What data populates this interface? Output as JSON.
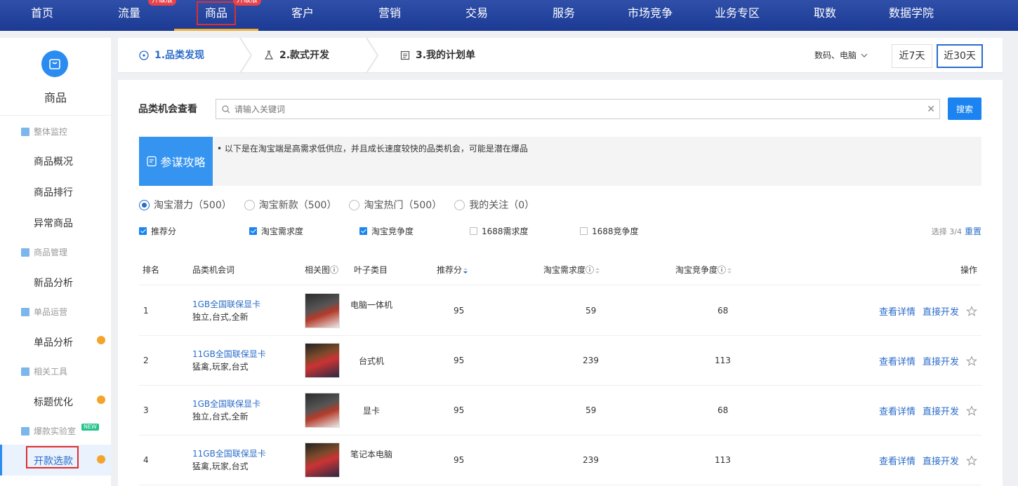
{
  "topnav": {
    "items": [
      {
        "label": "首页"
      },
      {
        "label": "流量",
        "badge": "升级版"
      },
      {
        "label": "商品",
        "badge": "升级版",
        "active": true
      },
      {
        "label": "客户"
      },
      {
        "label": "营销"
      },
      {
        "label": "交易"
      },
      {
        "label": "服务"
      },
      {
        "label": "市场竞争"
      },
      {
        "label": "业务专区"
      },
      {
        "label": "取数"
      },
      {
        "label": "数据学院"
      }
    ]
  },
  "sidebar": {
    "title": "商品",
    "groups": [
      {
        "label": "整体监控",
        "items": [
          "商品概况",
          "商品排行",
          "异常商品"
        ]
      },
      {
        "label": "商品管理",
        "items": [
          "新品分析"
        ]
      },
      {
        "label": "单品运营",
        "items": [
          "单品分析"
        ]
      },
      {
        "label": "相关工具",
        "items": [
          "标题优化"
        ]
      },
      {
        "label": "爆款实验室",
        "tag": "NEW",
        "items": [
          "开款选款"
        ]
      }
    ]
  },
  "steps": [
    {
      "label": "1.品类发现",
      "icon": "compass-icon",
      "active": true
    },
    {
      "label": "2.款式开发",
      "icon": "flask-icon"
    },
    {
      "label": "3.我的计划单",
      "icon": "list-icon"
    }
  ],
  "category_select": "数码、电脑",
  "ranges": [
    "近7天",
    "近30天"
  ],
  "search": {
    "title": "品类机会查看",
    "placeholder": "请输入关键词",
    "button": "搜索"
  },
  "tips": {
    "badge": "参谋攻略",
    "text": "• 以下是在淘宝端是高需求低供应，并且成长速度较快的品类机会，可能是潜在爆品"
  },
  "radios": [
    "淘宝潜力（500）",
    "淘宝新款（500）",
    "淘宝热门（500）",
    "我的关注（0）"
  ],
  "checks": [
    {
      "label": "推荐分",
      "checked": true
    },
    {
      "label": "淘宝需求度",
      "checked": true
    },
    {
      "label": "淘宝竞争度",
      "checked": true
    },
    {
      "label": "1688需求度",
      "checked": false
    },
    {
      "label": "1688竞争度",
      "checked": false
    }
  ],
  "selection": {
    "info": "选择 3/4",
    "reset": "重置"
  },
  "table": {
    "headers": [
      "排名",
      "品类机会词",
      "相关图",
      "叶子类目",
      "推荐分",
      "淘宝需求度",
      "淘宝竞争度",
      "操作"
    ],
    "rows": [
      {
        "rank": "1",
        "word": "1GB全国联保显卡",
        "tags": "独立,台式,全新",
        "cat": "电脑一体机",
        "score": "95",
        "demand": "59",
        "compete": "68"
      },
      {
        "rank": "2",
        "word": "11GB全国联保显卡",
        "tags": "猛禽,玩家,台式",
        "cat": "台式机",
        "score": "95",
        "demand": "239",
        "compete": "113"
      },
      {
        "rank": "3",
        "word": "1GB全国联保显卡",
        "tags": "独立,台式,全新",
        "cat": "显卡",
        "score": "95",
        "demand": "59",
        "compete": "68"
      },
      {
        "rank": "4",
        "word": "11GB全国联保显卡",
        "tags": "猛禽,玩家,台式",
        "cat": "笔记本电脑",
        "score": "95",
        "demand": "239",
        "compete": "113"
      }
    ],
    "ops": {
      "detail": "查看详情",
      "develop": "直接开发"
    }
  },
  "colors": {
    "nav_bg": "#1c3a94",
    "accent": "#2a6cc9",
    "button": "#1c84f0",
    "dot": "#f3a42b",
    "highlight": "#e02d2d"
  }
}
